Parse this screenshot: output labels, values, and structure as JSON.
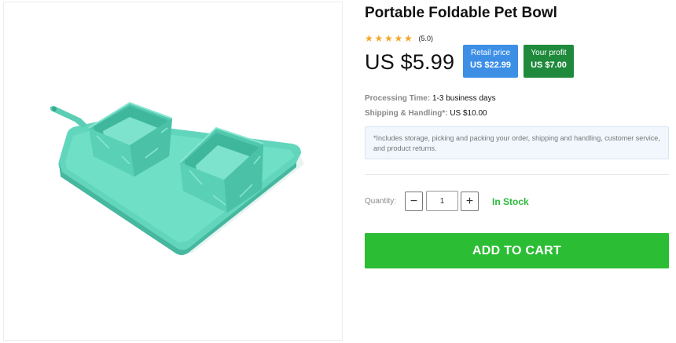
{
  "product": {
    "title": "Portable Foldable Pet Bowl",
    "rating": 5.0,
    "rating_text": "(5.0)",
    "stars_filled": 5,
    "price": "US $5.99",
    "retail_label": "Retail price",
    "retail_value": "US $22.99",
    "profit_label": "Your profit",
    "profit_value": "US $7.00"
  },
  "details": {
    "processing_label": "Processing Time:",
    "processing_value": "1-3 business days",
    "shipping_label": "Shipping & Handling*:",
    "shipping_value": "US $10.00",
    "note": "*Includes storage, picking and packing your order, shipping and handling, customer service, and product returns."
  },
  "purchase": {
    "quantity_label": "Quantity:",
    "quantity_value": "1",
    "minus_symbol": "−",
    "plus_symbol": "+",
    "stock_status": "In Stock",
    "add_to_cart": "ADD TO CART"
  },
  "icons": {
    "star": "star-icon",
    "minus": "minus-icon",
    "plus": "plus-icon"
  },
  "colors": {
    "star": "#f5a623",
    "retail_badge": "#3d8fe6",
    "profit_badge": "#1f8a3c",
    "in_stock": "#2cb93d",
    "cart_button": "#2bbd34",
    "product_teal": "#5fd6bd"
  }
}
